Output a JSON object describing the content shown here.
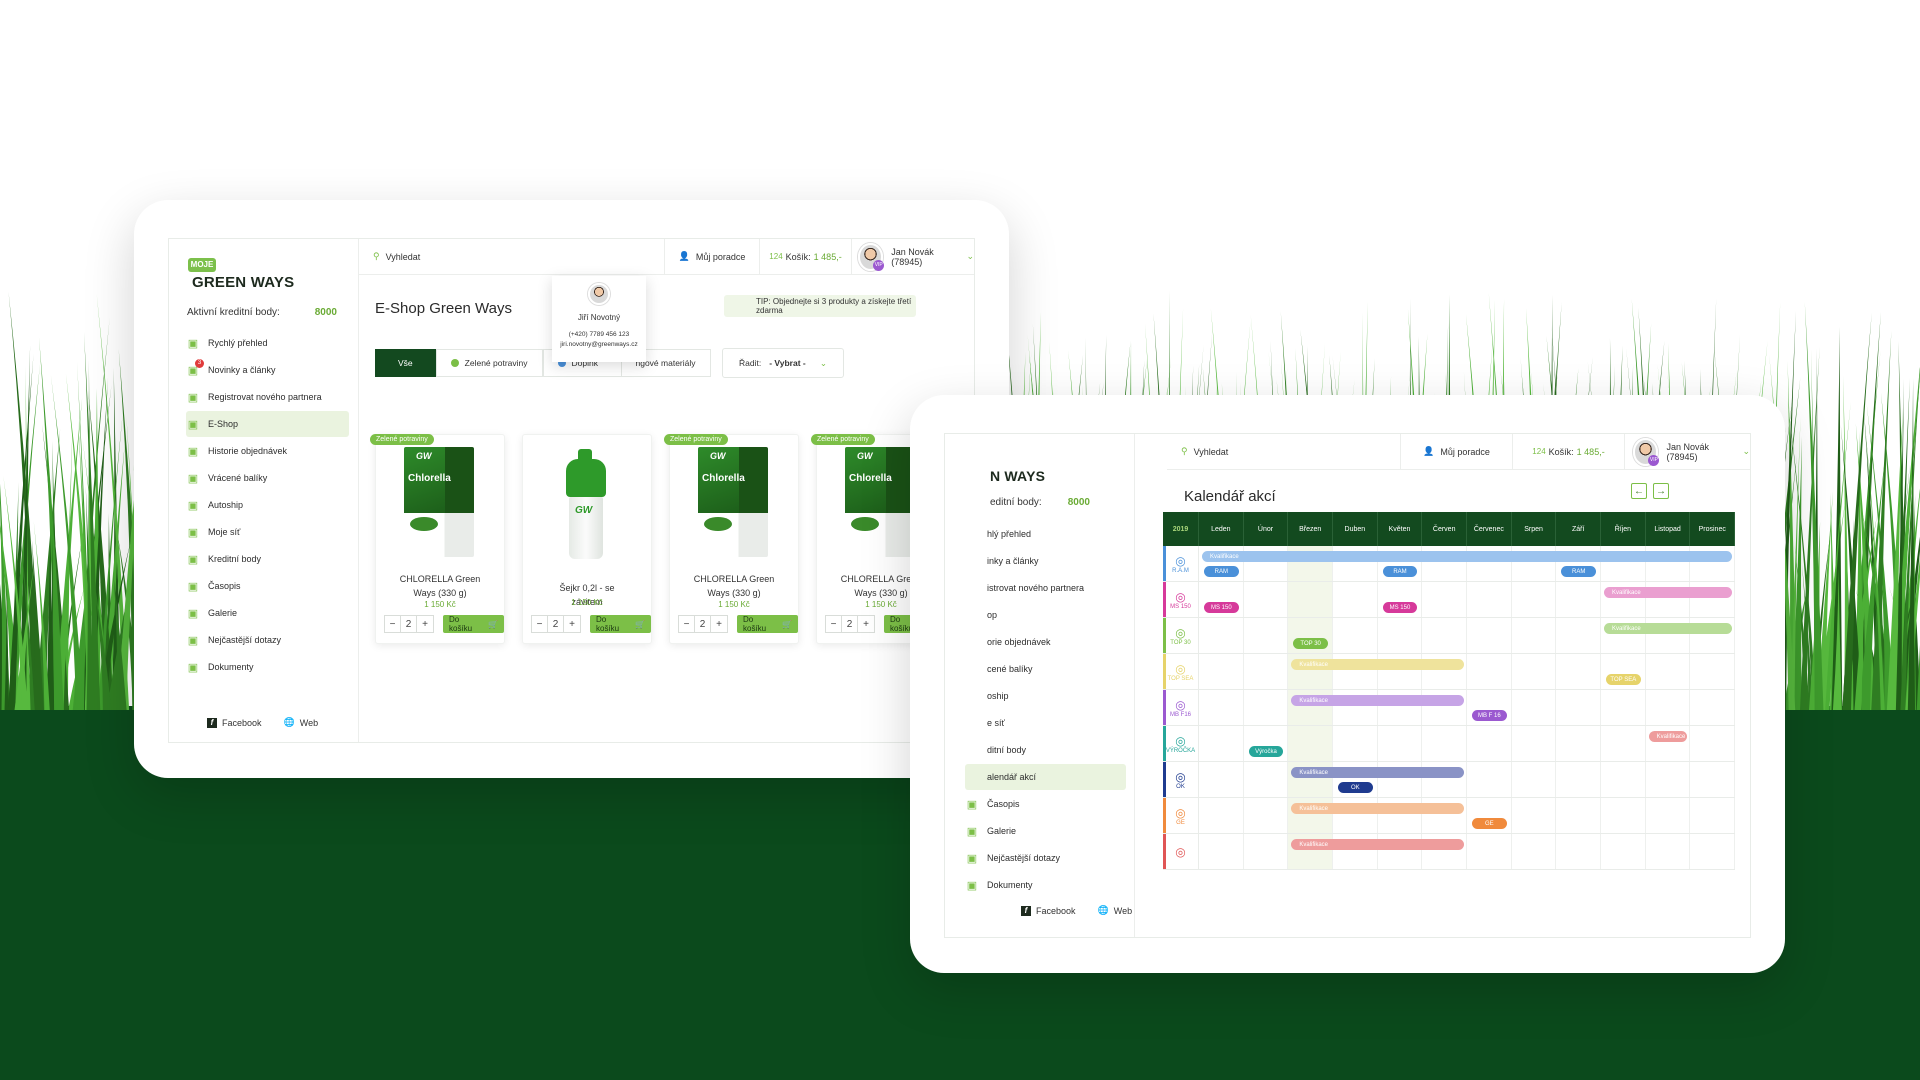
{
  "colors": {
    "brand_green": "#7cbf47",
    "dark_green": "#134a1f",
    "background_dark": "#0b4a1c"
  },
  "tablet1": {
    "logo_badge": "MOJE",
    "logo_name": "GREEN WAYS",
    "credits_label": "Aktivní kreditní body:",
    "credits_value": "8000",
    "nav": [
      {
        "label": "Rychlý přehled",
        "icon": "home-icon"
      },
      {
        "label": "Novinky a články",
        "icon": "news-icon",
        "badge": "3"
      },
      {
        "label": "Registrovat nového partnera",
        "icon": "add-user-icon"
      },
      {
        "label": "E-Shop",
        "icon": "shop-icon",
        "active": true
      },
      {
        "label": "Historie objednávek",
        "icon": "history-icon"
      },
      {
        "label": "Vrácené balíky",
        "icon": "package-icon"
      },
      {
        "label": "Autoship",
        "icon": "autoship-icon"
      },
      {
        "label": "Moje síť",
        "icon": "network-icon"
      },
      {
        "label": "Kreditní body",
        "icon": "credit-icon"
      },
      {
        "label": "Časopis",
        "icon": "magazine-icon"
      },
      {
        "label": "Galerie",
        "icon": "gallery-icon"
      },
      {
        "label": "Nejčastější dotazy",
        "icon": "faq-icon"
      },
      {
        "label": "Dokumenty",
        "icon": "documents-icon"
      }
    ],
    "footer": {
      "facebook": "Facebook",
      "web": "Web"
    },
    "topbar": {
      "search_placeholder": "Vyhledat",
      "advisor": "Můj poradce",
      "cart_count": "124",
      "cart_label": "Košík:",
      "cart_total": "1 485,-",
      "user": "Jan Novák (78945)",
      "user_badge": "VIP"
    },
    "advisor_popup": {
      "name": "Jiří Novotný",
      "phone": "(+420) 7789 456 123",
      "email": "jiri.novotny@greenways.cz"
    },
    "page_title": "E-Shop Green Ways",
    "tip": "TIP: Objednejte si 3 produkty a získejte třetí zdarma",
    "filters": [
      {
        "label": "Vše",
        "active": true
      },
      {
        "label": "Zelené potraviny",
        "dot": "#7cbf47"
      },
      {
        "label": "Doplňk",
        "dot": "#4a90d9"
      },
      {
        "label": "ngové materiály"
      }
    ],
    "sort": {
      "label": "Řadit:",
      "value": "- Vybrat -"
    },
    "products": [
      {
        "tag": "Zelené potraviny",
        "name": "CHLORELLA Green Ways (330 g)",
        "price": "1 150 Kč",
        "qty": "2",
        "button": "Do košíku",
        "type": "box",
        "box_brand": "GW",
        "box_name": "Chlorella"
      },
      {
        "tag": "",
        "name": "Šejkr 0,2l - se závitem",
        "price": "1 150 Kč",
        "qty": "2",
        "button": "Do košíku",
        "type": "shaker",
        "box_brand": "GW",
        "box_name": ""
      },
      {
        "tag": "Zelené potraviny",
        "name": "CHLORELLA Green Ways (330 g)",
        "price": "1 150 Kč",
        "qty": "2",
        "button": "Do košíku",
        "type": "box",
        "box_brand": "GW",
        "box_name": "Chlorella"
      },
      {
        "tag": "Zelené potraviny",
        "name": "CHLORELLA Green Ways (330 g)",
        "price": "1 150 Kč",
        "qty": "2",
        "button": "Do košíku",
        "type": "box",
        "box_brand": "GW",
        "box_name": "Chlorella"
      }
    ]
  },
  "tablet2": {
    "logo_name_partial": "N WAYS",
    "credits_label_partial": "editní body:",
    "credits_value": "8000",
    "nav": [
      {
        "label": "hlý přehled"
      },
      {
        "label": "inky a články"
      },
      {
        "label": "istrovat nového partnera"
      },
      {
        "label": "op"
      },
      {
        "label": "orie objednávek"
      },
      {
        "label": "cené balíky"
      },
      {
        "label": "oship"
      },
      {
        "label": "e síť"
      },
      {
        "label": "ditní body"
      },
      {
        "label": "alendář akcí",
        "active": true
      },
      {
        "label": "Časopis",
        "icon": "magazine-icon"
      },
      {
        "label": "Galerie",
        "icon": "gallery-icon"
      },
      {
        "label": "Nejčastější dotazy",
        "icon": "faq-icon"
      },
      {
        "label": "Dokumenty",
        "icon": "documents-icon"
      }
    ],
    "footer": {
      "facebook": "Facebook",
      "web": "Web"
    },
    "topbar": {
      "search_placeholder": "Vyhledat",
      "advisor": "Můj poradce",
      "cart_count": "124",
      "cart_label": "Košík:",
      "cart_total": "1 485,-",
      "user": "Jan Novák (78945)",
      "user_badge": "VIP"
    },
    "page_title": "Kalendář akcí",
    "year": "2019",
    "months": [
      "Leden",
      "Únor",
      "Březen",
      "Duben",
      "Květen",
      "Červen",
      "Červenec",
      "Srpen",
      "Září",
      "Říjen",
      "Listopad",
      "Prosinec"
    ],
    "rows": [
      {
        "label": "R.A.M",
        "color": "#4a90d9",
        "bars": [
          {
            "text": "Kvalifikace",
            "from": 1,
            "to": 12,
            "color": "#9cc3ee",
            "lane": 0
          }
        ],
        "pills": [
          {
            "text": "RAM",
            "month": 1,
            "color": "#4a90d9"
          },
          {
            "text": "RAM",
            "month": 5,
            "color": "#4a90d9"
          },
          {
            "text": "RAM",
            "month": 9,
            "color": "#4a90d9"
          }
        ]
      },
      {
        "label": "MS 150",
        "color": "#d6399a",
        "bars": [
          {
            "text": "Kvalifikace",
            "from": 10,
            "to": 12,
            "color": "#ea9fd0",
            "lane": 0
          }
        ],
        "pills": [
          {
            "text": "MS 150",
            "month": 1,
            "color": "#d6399a"
          },
          {
            "text": "MS 150",
            "month": 5,
            "color": "#d6399a"
          }
        ]
      },
      {
        "label": "TOP 30",
        "color": "#7cbf47",
        "bars": [
          {
            "text": "Kvalifikace",
            "from": 10,
            "to": 12,
            "color": "#b7dc97",
            "lane": 0
          }
        ],
        "pills": [
          {
            "text": "TOP 30",
            "month": 3,
            "color": "#7cbf47"
          }
        ]
      },
      {
        "label": "TOP SEA",
        "color": "#e6d36a",
        "bars": [
          {
            "text": "Kvalifikace",
            "from": 3,
            "to": 6,
            "color": "#efe39c",
            "lane": 0
          }
        ],
        "pills": [
          {
            "text": "TOP SEA",
            "month": 10,
            "color": "#e6d36a"
          }
        ]
      },
      {
        "label": "MB F16",
        "color": "#9b59d0",
        "bars": [
          {
            "text": "Kvalifikace",
            "from": 3,
            "to": 6,
            "color": "#c6a4e6",
            "lane": 0
          }
        ],
        "pills": [
          {
            "text": "MB F 16",
            "month": 7,
            "color": "#9b59d0"
          }
        ]
      },
      {
        "label": "VÝROČKA",
        "color": "#26a69a",
        "bars": [
          {
            "text": "Kvalifikace",
            "from": 11,
            "to": 11,
            "color": "#ee9c9c",
            "lane": 0
          }
        ],
        "pills": [
          {
            "text": "Výročka",
            "month": 2,
            "color": "#26a69a"
          }
        ]
      },
      {
        "label": "OK",
        "color": "#1f3b8f",
        "bars": [
          {
            "text": "Kvalifikace",
            "from": 3,
            "to": 6,
            "color": "#8a93c6",
            "lane": 0
          }
        ],
        "pills": [
          {
            "text": "OK",
            "month": 4,
            "color": "#1f3b8f"
          }
        ]
      },
      {
        "label": "GE",
        "color": "#f08a3c",
        "bars": [
          {
            "text": "Kvalifikace",
            "from": 3,
            "to": 6,
            "color": "#f5c098",
            "lane": 0
          }
        ],
        "pills": [
          {
            "text": "GE",
            "month": 7,
            "color": "#f08a3c"
          }
        ]
      },
      {
        "label": "",
        "color": "#e05555",
        "bars": [
          {
            "text": "Kvalifikace",
            "from": 3,
            "to": 6,
            "color": "#ee9c9c",
            "lane": 0
          }
        ],
        "pills": []
      }
    ]
  }
}
